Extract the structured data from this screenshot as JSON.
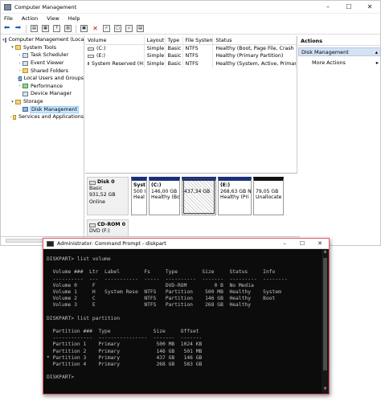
{
  "cm": {
    "title": "Computer Management",
    "menu": [
      "File",
      "Action",
      "View",
      "Help"
    ],
    "tree": [
      {
        "label": "Computer Management (Local",
        "level": 0,
        "exp": "▾",
        "icon": "computer",
        "sel": false
      },
      {
        "label": "System Tools",
        "level": 1,
        "exp": "▾",
        "icon": "tools",
        "sel": false
      },
      {
        "label": "Task Scheduler",
        "level": 2,
        "exp": "›",
        "icon": "clock",
        "sel": false
      },
      {
        "label": "Event Viewer",
        "level": 2,
        "exp": "›",
        "icon": "log",
        "sel": false
      },
      {
        "label": "Shared Folders",
        "level": 2,
        "exp": "›",
        "icon": "folder",
        "sel": false
      },
      {
        "label": "Local Users and Groups",
        "level": 2,
        "exp": "›",
        "icon": "users",
        "sel": false
      },
      {
        "label": "Performance",
        "level": 2,
        "exp": "›",
        "icon": "perf",
        "sel": false
      },
      {
        "label": "Device Manager",
        "level": 2,
        "exp": "",
        "icon": "device",
        "sel": false
      },
      {
        "label": "Storage",
        "level": 1,
        "exp": "▾",
        "icon": "storage",
        "sel": false
      },
      {
        "label": "Disk Management",
        "level": 2,
        "exp": "",
        "icon": "disk",
        "sel": true
      },
      {
        "label": "Services and Applications",
        "level": 1,
        "exp": "›",
        "icon": "services",
        "sel": false
      }
    ],
    "columns": [
      "Volume",
      "Layout",
      "Type",
      "File System",
      "Status"
    ],
    "volumes": [
      [
        "(C:)",
        "Simple",
        "Basic",
        "NTFS",
        "Healthy (Boot, Page File, Crash"
      ],
      [
        "(E:)",
        "Simple",
        "Basic",
        "NTFS",
        "Healthy (Primary Partition)"
      ],
      [
        "System Reserved (H:)",
        "Simple",
        "Basic",
        "NTFS",
        "Healthy (System, Active, Primary P"
      ]
    ],
    "disk0": {
      "lines": [
        "Disk 0",
        "Basic",
        "931,52 GB",
        "Online"
      ],
      "parts": [
        {
          "lines": [
            "Syst",
            "500 I",
            "Heal"
          ],
          "w": 20,
          "type": "primary"
        },
        {
          "lines": [
            "(C:)",
            "146,00 GB",
            "Healthy (Bo"
          ],
          "w": 39,
          "type": "primary"
        },
        {
          "lines": [
            "",
            "437,34 GB",
            ""
          ],
          "w": 43,
          "type": "hatched"
        },
        {
          "lines": [
            "(E:)",
            "268,63 GB N",
            "Healthy (Pri"
          ],
          "w": 42,
          "type": "primary"
        },
        {
          "lines": [
            "",
            "79,05 GB",
            "Unallocate"
          ],
          "w": 38,
          "type": "unalloc"
        }
      ]
    },
    "cdrom": {
      "lines": [
        "CD-ROM 0",
        "DVD (F:)"
      ]
    },
    "actions": {
      "title": "Actions",
      "section": "Disk Management",
      "item": "More Actions"
    }
  },
  "cmd": {
    "title": "Administrator: Command Prompt - diskpart",
    "lines": [
      "DISKPART> list volume",
      "",
      "  Volume ###  Ltr  Label        Fs     Type        Size     Status     Info",
      "  ----------  ---  -----------  -----  ----------  -------  ---------  --------",
      "  Volume 0     F                       DVD-ROM         0 B  No Media",
      "  Volume 1     H   System Rese  NTFS   Partition    500 MB  Healthy    System",
      "  Volume 2     C                NTFS   Partition    146 GB  Healthy    Boot",
      "  Volume 3     E                NTFS   Partition    268 GB  Healthy",
      "",
      "DISKPART> list partition",
      "",
      "  Partition ###  Type              Size     Offset",
      "  -------------  ----------------  -------  -------",
      "  Partition 1    Primary            500 MB  1024 KB",
      "  Partition 2    Primary            146 GB   501 MB",
      "* Partition 3    Primary            437 GB   146 GB",
      "  Partition 4    Primary            268 GB   583 GB",
      "",
      "DISKPART> "
    ]
  }
}
